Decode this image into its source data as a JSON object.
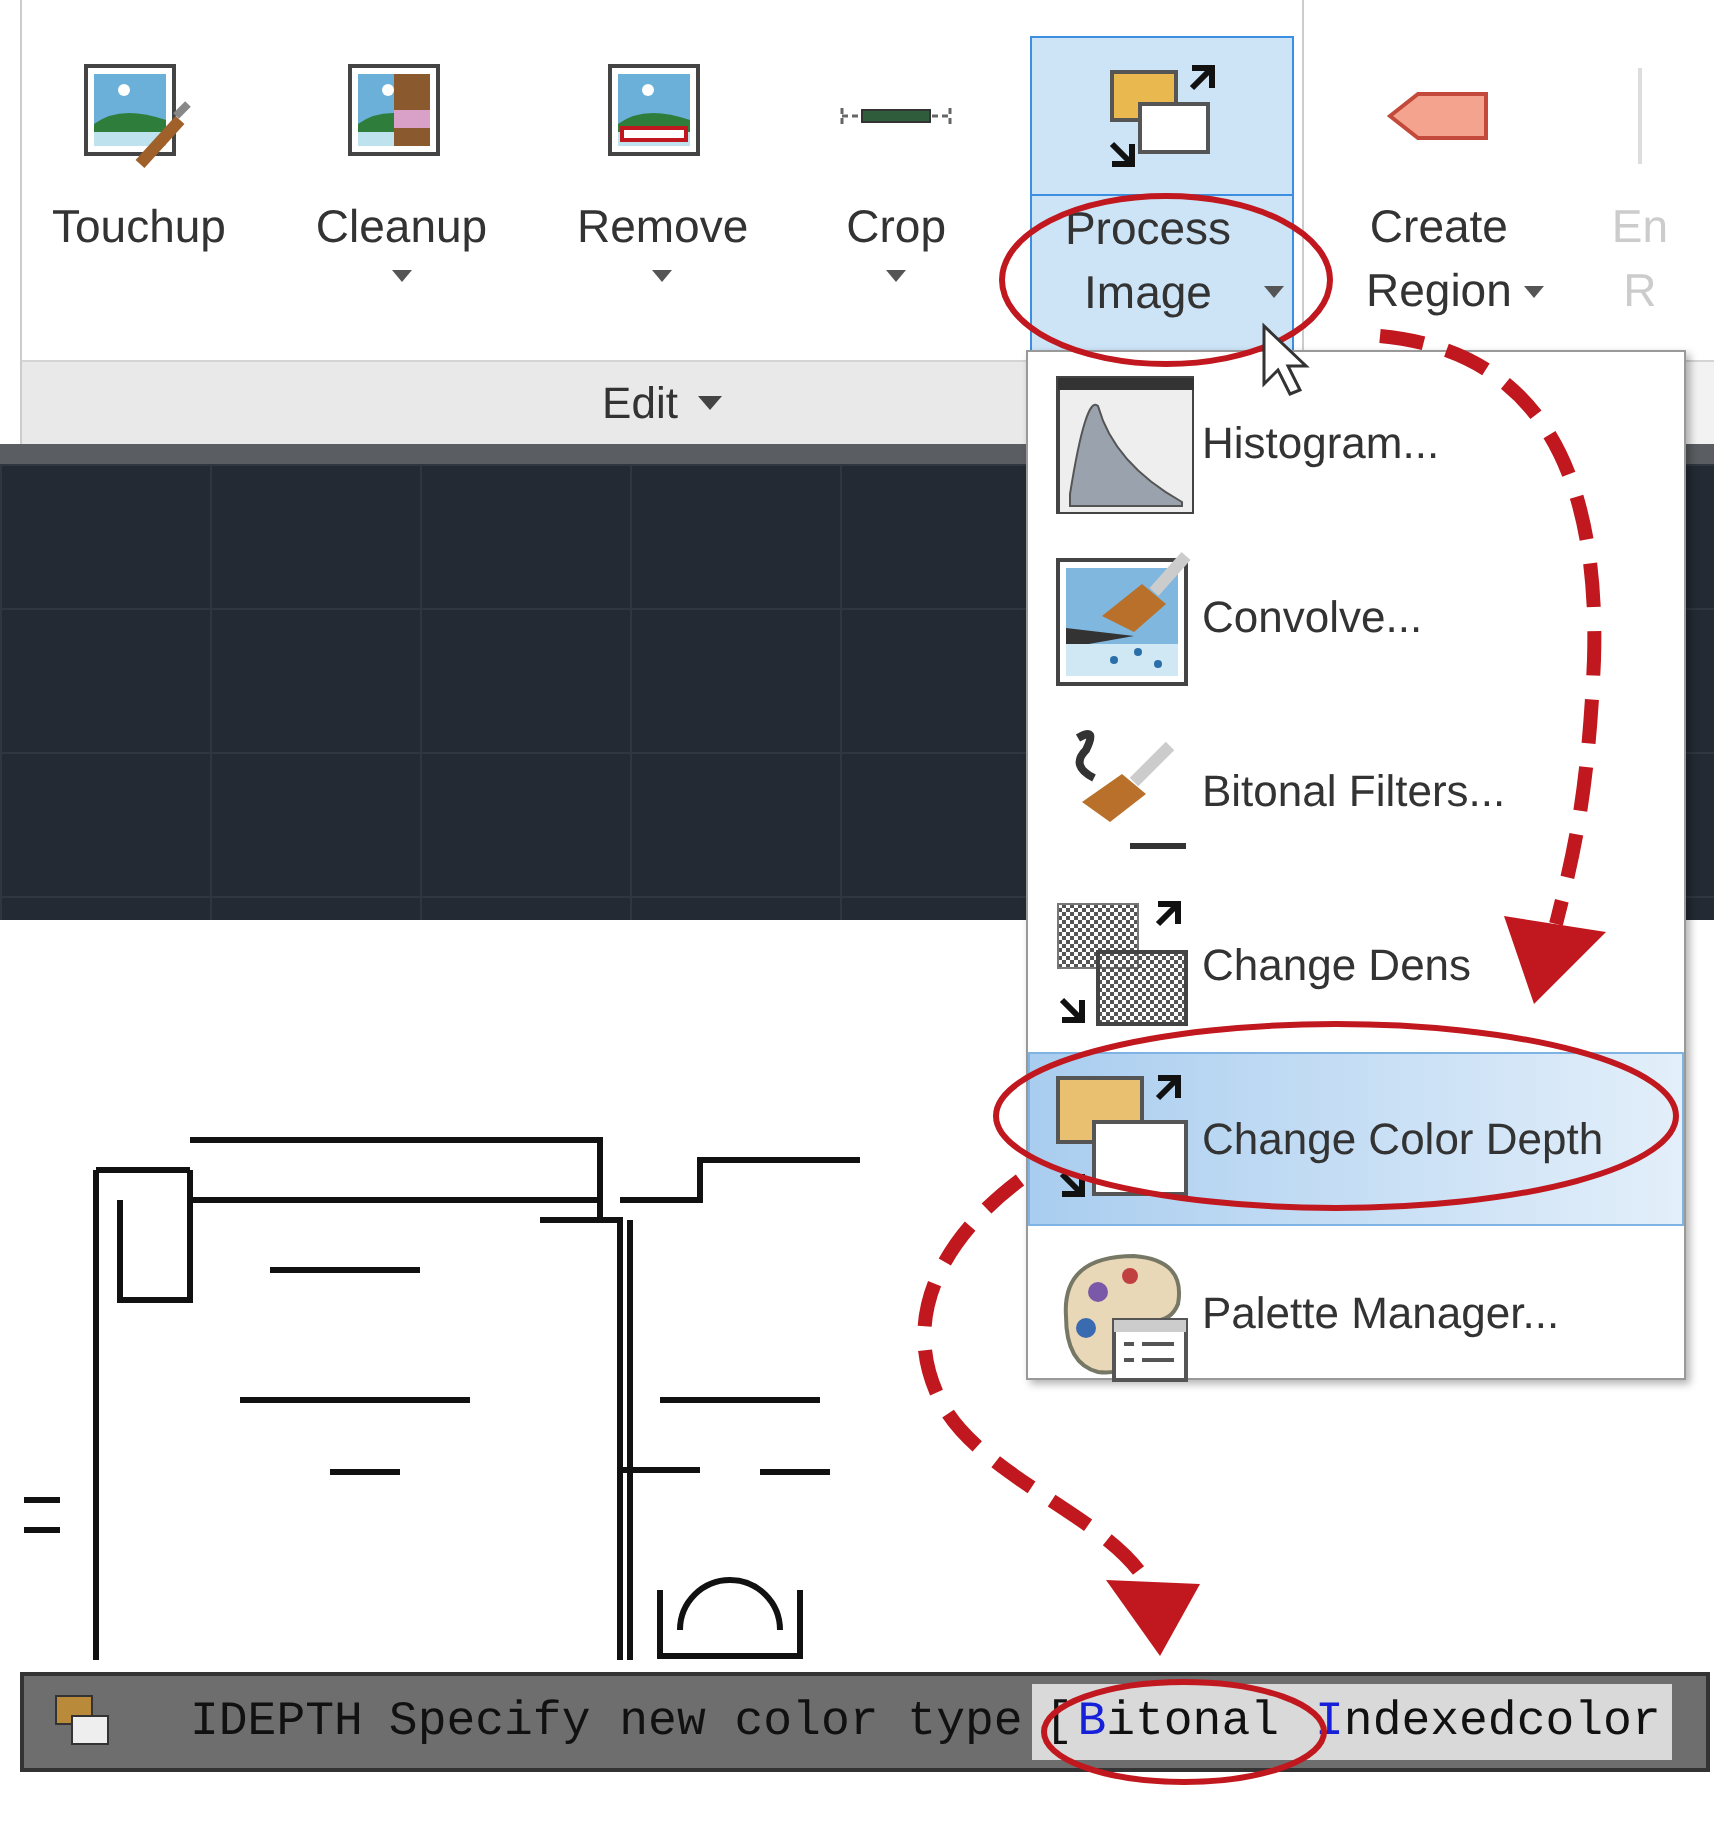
{
  "ribbon": {
    "panels": [
      {
        "label": "Edit",
        "buttons": [
          {
            "lines": [
              "Touchup"
            ],
            "dropdown": false,
            "selected": false,
            "disabled": false
          },
          {
            "lines": [
              "Cleanup"
            ],
            "dropdown": true,
            "selected": false,
            "disabled": false
          },
          {
            "lines": [
              "Remove"
            ],
            "dropdown": true,
            "selected": false,
            "disabled": false
          },
          {
            "lines": [
              "Crop"
            ],
            "dropdown": true,
            "selected": false,
            "disabled": false
          },
          {
            "lines": [
              "Process",
              "Image"
            ],
            "dropdown": true,
            "selected": true,
            "disabled": false
          }
        ]
      },
      {
        "buttons": [
          {
            "lines": [
              "Create",
              "Region"
            ],
            "dropdown": true,
            "selected": false,
            "disabled": false
          },
          {
            "lines": [
              "En",
              "R"
            ],
            "dropdown": false,
            "selected": false,
            "disabled": true
          }
        ]
      }
    ]
  },
  "menu": {
    "items": [
      {
        "label": "Histogram...",
        "selected": false
      },
      {
        "label": "Convolve...",
        "selected": false
      },
      {
        "label": "Bitonal Filters...",
        "selected": false
      },
      {
        "label": "Change Dens",
        "selected": false
      },
      {
        "label": "Change Color Depth",
        "selected": true
      },
      {
        "label": "Palette Manager...",
        "selected": false
      }
    ]
  },
  "command_line": {
    "command": "IDEPTH",
    "prompt": "Specify new color type",
    "bracket": "[",
    "options": [
      {
        "key": "B",
        "rest": "itonal"
      },
      {
        "key": "I",
        "rest": "ndexedcolor"
      }
    ]
  }
}
